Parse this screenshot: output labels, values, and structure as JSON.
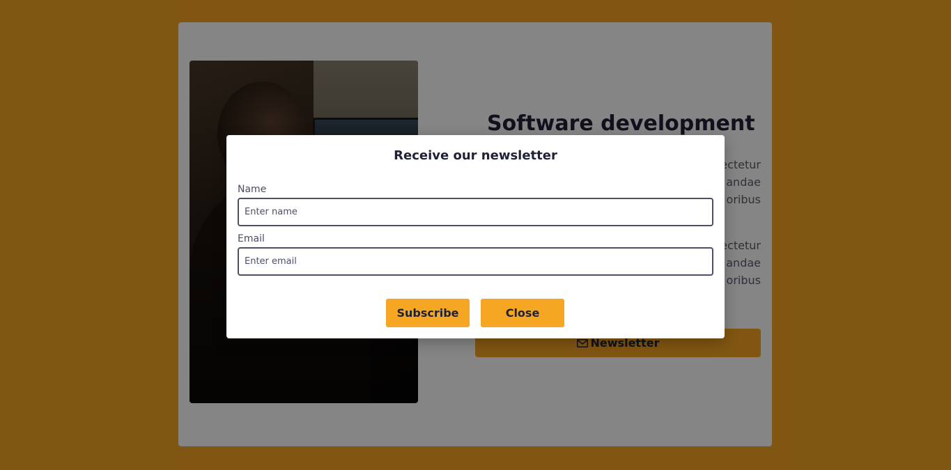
{
  "page": {
    "background_color": "#f5a623",
    "overlay_color": "rgba(0,0,0,0.48)"
  },
  "card": {
    "image": {
      "description_icon": "person-at-computer-photo"
    },
    "title": "Software development",
    "paragraphs": [
      "ectetur\nandae\noribus",
      "ectetur\nandae\noribus"
    ],
    "newsletter_button": {
      "icon": "envelope-icon",
      "label": "Newsletter"
    }
  },
  "modal": {
    "title": "Receive our newsletter",
    "name_label": "Name",
    "name_placeholder": "Enter name",
    "name_value": "",
    "email_label": "Email",
    "email_placeholder": "Enter email",
    "email_value": "",
    "subscribe_label": "Subscribe",
    "close_label": "Close"
  },
  "colors": {
    "accent": "#f5a623",
    "text_dark": "#1f2236",
    "text_muted": "#5b5e70",
    "input_border": "#4d4f66"
  }
}
